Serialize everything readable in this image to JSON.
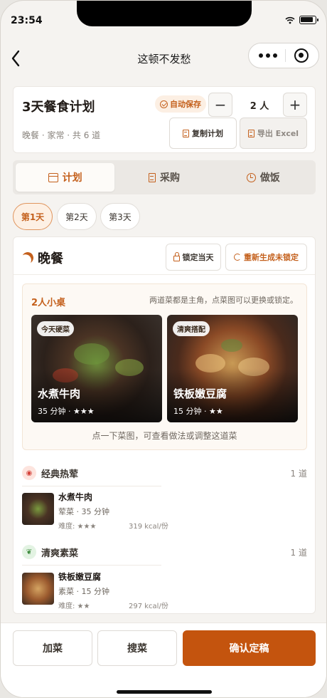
{
  "status": {
    "time": "23:54"
  },
  "nav": {
    "title": "这顿不发愁"
  },
  "plan": {
    "title": "3天餐食计划",
    "subtitle": "晚餐 · 家常 · 共 6 道",
    "autosave": "自动保存",
    "people": "2 人",
    "minus": "−",
    "plus": "+",
    "copy_label": "复制计划",
    "export_label": "导出 Excel"
  },
  "tabs": [
    {
      "label": "计划",
      "icon": "calendar-icon",
      "active": true
    },
    {
      "label": "采购",
      "icon": "receipt-icon",
      "active": false
    },
    {
      "label": "做饭",
      "icon": "timer-icon",
      "active": false
    }
  ],
  "days": [
    {
      "label": "第1天",
      "active": true
    },
    {
      "label": "第2天",
      "active": false
    },
    {
      "label": "第3天",
      "active": false
    }
  ],
  "meal": {
    "title": "晚餐",
    "lock_label": "锁定当天",
    "regen_label": "重新生成未锁定",
    "table": {
      "title": "2人小桌",
      "hint": "两道菜都是主角，点菜图可以更换或锁定。",
      "footer": "点一下菜图，可查看做法或调整这道菜",
      "dishes": [
        {
          "tag": "今天硬菜",
          "name": "水煮牛肉",
          "meta": "35 分钟 · ★★★"
        },
        {
          "tag": "清爽搭配",
          "name": "铁板嫩豆腐",
          "meta": "15 分钟 · ★★"
        }
      ]
    },
    "categories": [
      {
        "title": "经典热荤",
        "count": "1 道",
        "icon": "meat-icon",
        "item": {
          "name": "水煮牛肉",
          "sub": "荤菜 · 35 分钟",
          "difficulty": "难度: ★★★",
          "kcal": "319 kcal/份"
        }
      },
      {
        "title": "清爽素菜",
        "count": "1 道",
        "icon": "leaf-icon",
        "item": {
          "name": "铁板嫩豆腐",
          "sub": "素菜 · 15 分钟",
          "difficulty": "难度: ★★",
          "kcal": "297 kcal/份"
        }
      }
    ]
  },
  "bottom": {
    "add_label": "加菜",
    "search_label": "搜菜",
    "confirm_label": "确认定稿"
  },
  "colors": {
    "accent": "#c4601c",
    "confirm": "#c4540e",
    "background": "#f5f3f0"
  }
}
